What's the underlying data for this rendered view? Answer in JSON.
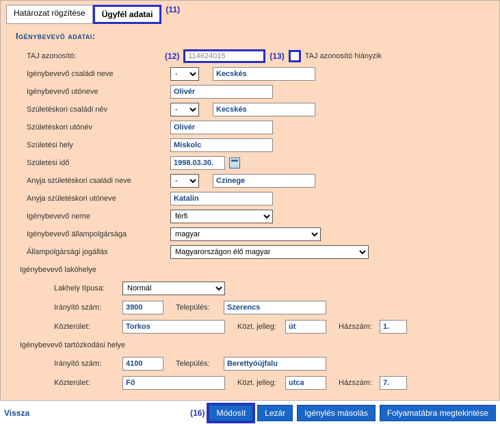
{
  "tabs": {
    "tab1": "Határozat rögzítése",
    "tab2": "Ügyfél adatai"
  },
  "annotations": {
    "a11": "(11)",
    "a12": "(12)",
    "a13": "(13)",
    "a16": "(16)"
  },
  "section_title": "Igénybevevő adatai:",
  "labels": {
    "taj": "TAJ azonosító:",
    "taj_missing": "TAJ azonosító hiányzik",
    "csaladi": "Igénybevevő családi neve",
    "utonev": "Igénybevevő utóneve",
    "sz_csaladi": "Születéskori családi név",
    "sz_utonev": "Születéskori utónév",
    "sz_hely": "Születési hely",
    "sz_ido": "Születési idő",
    "anyja_csaladi": "Anyja születéskori családi neve",
    "anyja_uto": "Anyja születéskori utóneve",
    "neme": "Igénybevevő neme",
    "allampolg": "Igénybevevő állampolgársága",
    "jogallas": "Állampolgársági jogállás",
    "lakohely_hdr": "Igénybevevő lakóhelye",
    "lakhely_tipus": "Lakhely típusa:",
    "irsz": "Irányító szám:",
    "telepules": "Település:",
    "kozterulet": "Közterület:",
    "kozt_jelleg": "Közt. jelleg:",
    "hazszam": "Házszám:",
    "tart_hdr": "Igénybevevő tartózkodási helye"
  },
  "values": {
    "taj": "114624015",
    "prefix1": "-",
    "csaladi": "Kecskés",
    "utonev": "Olivér",
    "prefix2": "-",
    "sz_csaladi": "Kecskés",
    "sz_utonev": "Olivér",
    "sz_hely": "Miskolc",
    "sz_ido": "1998.03.30.",
    "prefix3": "-",
    "anyja_csaladi": "Czinege",
    "anyja_uto": "Katalin",
    "neme": "férfi",
    "allampolg": "magyar",
    "jogallas": "Magyarországon élő magyar",
    "lakhely_tipus": "Normál",
    "lak_irsz": "3900",
    "lak_telepules": "Szerencs",
    "lak_kozterulet": "Torkos",
    "lak_jelleg": "út",
    "lak_hazszam": "1.",
    "tart_irsz": "4100",
    "tart_telepules": "Berettyóújfalu",
    "tart_kozterulet": "Fő",
    "tart_jelleg": "utca",
    "tart_hazszam": "7."
  },
  "footer": {
    "vissza": "Vissza",
    "modosit": "Módosít",
    "lezar": "Lezár",
    "igenyles_masolas": "Igénylés másolás",
    "folyamatabra": "Folyamatábra megtekintése"
  }
}
